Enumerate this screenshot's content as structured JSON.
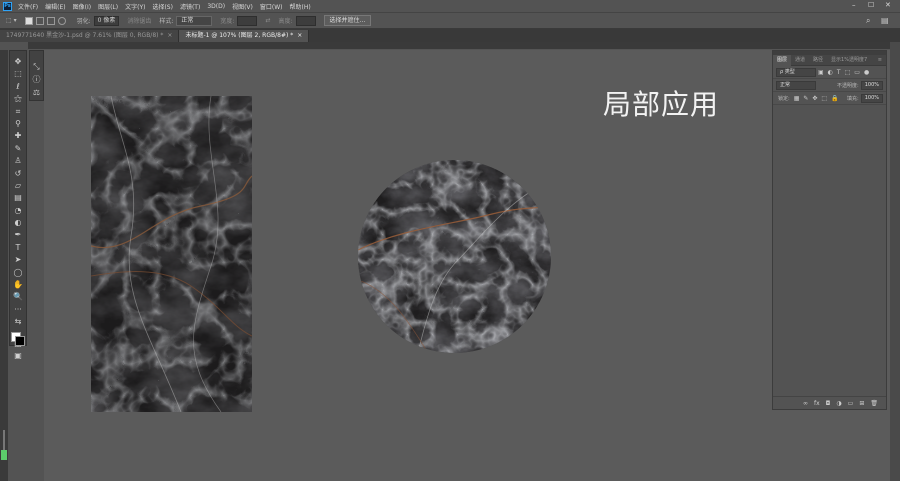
{
  "app": {
    "logo": "Ps"
  },
  "menubar": {
    "items": [
      "文件(F)",
      "编辑(E)",
      "图像(I)",
      "图层(L)",
      "文字(Y)",
      "选择(S)",
      "滤镜(T)",
      "3D(D)",
      "视图(V)",
      "窗口(W)",
      "帮助(H)"
    ],
    "minimize": "–",
    "maximize": "☐",
    "close": "✕"
  },
  "options": {
    "feather_label": "羽化:",
    "feather_value": "0 像素",
    "antialias_label": "消除锯齿",
    "style_label": "样式:",
    "style_value": "正常",
    "width_label": "宽度:",
    "height_label": "高度:",
    "select_subject_button": "选择并遮住...",
    "search_icon": "⌕",
    "workspace_icon": "▤"
  },
  "tabs": [
    {
      "label": "1749771640 黑金沙-1.psd @ 7.61% (图层 0, RGB/8) *",
      "close": "×"
    },
    {
      "label": "未标题-1 @ 107% (图层 2, RGB/8#) *",
      "close": "×"
    }
  ],
  "canvas": {
    "title_text": "局部应用",
    "background": "#5b5b5b"
  },
  "layers_panel": {
    "tabs": [
      "图层",
      "通道",
      "路径",
      "显示1%透明度7"
    ],
    "filter_label": "ρ 类型",
    "blend_mode": "正常",
    "opacity_label": "不透明度:",
    "opacity_value": "100%",
    "lock_label": "锁定:",
    "fill_label": "填充:",
    "fill_value": "100%",
    "footer_icons": [
      "∞",
      "fx",
      "◘",
      "◑",
      "▭",
      "⊞",
      "🗑"
    ]
  },
  "zoom_slider": {
    "level": 0.33
  }
}
